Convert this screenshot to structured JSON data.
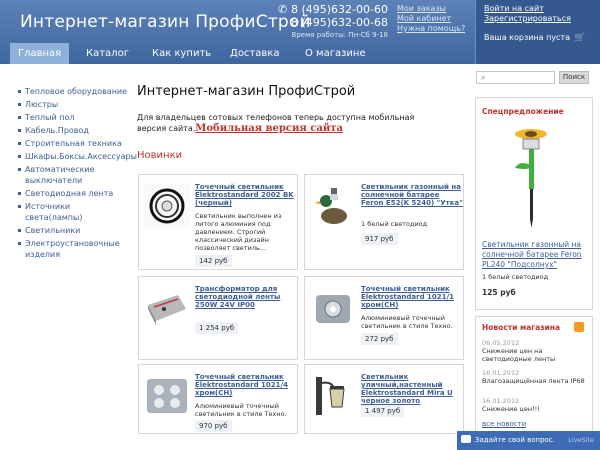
{
  "header": {
    "title": "Интернет-магазин ПрофиСтрой",
    "phone1": "8 (495)632-00-60",
    "phone2": "8 (495)632-00-68",
    "hours": "Время работы: Пн-Сб 9-18",
    "account_links": [
      "Мои заказы",
      "Мой кабинет",
      "Нужна помощь?"
    ],
    "auth": {
      "login": "Войти на сайт",
      "register": "Зарегистрироваться"
    },
    "cart": "Ваша корзина пуста"
  },
  "nav": {
    "items": [
      {
        "label": "Главная"
      },
      {
        "label": "Каталог"
      },
      {
        "label": "Как купить"
      },
      {
        "label": "Доставка"
      },
      {
        "label": "О магазине"
      }
    ]
  },
  "sidebar": {
    "items": [
      {
        "label": "Тепловое оборудование"
      },
      {
        "label": "Люстры"
      },
      {
        "label": "Теплый пол"
      },
      {
        "label": "Кабель.Провод"
      },
      {
        "label": "Строительная техника"
      },
      {
        "label": "Шкафы.Боксы.Аксессуары"
      },
      {
        "label": "Автоматические выключатели"
      },
      {
        "label": "Светодиодная лента"
      },
      {
        "label": "Источники света(лампы)"
      },
      {
        "label": "Светильники"
      },
      {
        "label": "Электроустановочные изделия"
      }
    ]
  },
  "main": {
    "title": "Интернет-магазин ПрофиСтрой",
    "mobile_note": "Для владельцев сотовых телефонов теперь доступна мобильная версия сайта.",
    "mobile_link": "Мобильная версия сайта",
    "new_section": "Новинки"
  },
  "products": [
    {
      "name": "Точечный светильник Elektrostandard 2002 BK (черный)",
      "desc": "Светильник выполнен из литого алюминия под давлением. Строгий классический дизайн позволяет светиль...",
      "price": "142 руб",
      "icon": "ring-spotlight"
    },
    {
      "name": "Светильник газонный на солнечной батарее Feron E52(K 5240) \"Утка\"",
      "desc": "1 белый светодиод",
      "price": "917 руб",
      "icon": "duck-lamp"
    },
    {
      "name": "Трансформатор для светодиодной ленты 250W 24V IP00",
      "desc": "",
      "price": "1 254 руб",
      "icon": "transformer"
    },
    {
      "name": "Точечный светильник Elektrostandard 1021/1 хром(CH)",
      "desc": "Алюминиевый точечный светильник в стиле Техно.",
      "price": "272 руб",
      "icon": "square-spotlight"
    },
    {
      "name": "Точечный светильник Elektrostandard 1021/4 хром(CH)",
      "desc": "Алюминиевый точечный светильник в стиле Техно.",
      "price": "970 руб",
      "icon": "quad-spotlight"
    },
    {
      "name": "Светильник уличный,настенный Elektrostandard Mira U черное золото",
      "desc": "",
      "price": "1 497 руб",
      "icon": "wall-lantern"
    }
  ],
  "search": {
    "placeholder": "",
    "button": "Поиск"
  },
  "special": {
    "title": "Спецпредложение",
    "name": "Светильник газонный на солнечной батарее Feron PL240 \"Подсолнух\"",
    "desc": "1 белый светодиод",
    "price": "125 руб"
  },
  "news": {
    "title": "Новости магазина",
    "items": [
      {
        "date": "06.05.2012",
        "text": "Снижение цен на светодиодные ленты"
      },
      {
        "date": "16.01.2012",
        "text": "Влагозащищённая лента IP68"
      },
      {
        "date": "16.01.2012",
        "text": "Снижение цен!!!"
      }
    ],
    "all": "все новости"
  },
  "chat": {
    "label": "Задайте свой вопрос.",
    "brand": "LiveSite"
  },
  "colors": {
    "header": "#4a72ad",
    "accent_red": "#c0322b",
    "link": "#3d5f96"
  }
}
